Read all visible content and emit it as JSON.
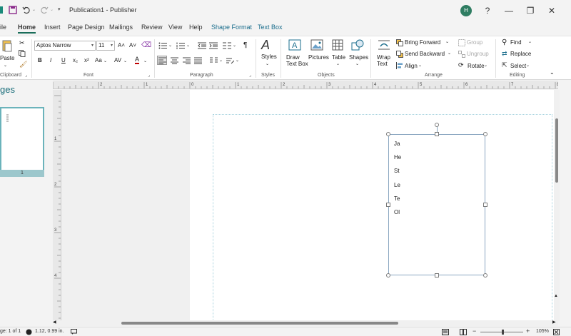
{
  "titlebar": {
    "title": "Publication1  -  Publisher",
    "avatar_initial": "H",
    "help": "?",
    "minimize": "—",
    "restore": "❐",
    "close": "✕"
  },
  "tabs": [
    "ile",
    "Home",
    "Insert",
    "Page Design",
    "Mailings",
    "Review",
    "View",
    "Help",
    "Shape Format",
    "Text Box"
  ],
  "ribbon": {
    "clipboard": {
      "paste": "Paste",
      "label": "Clipboard"
    },
    "font": {
      "name": "Aptos Narrow",
      "size": "11",
      "label": "Font",
      "bold": "B",
      "italic": "I",
      "underline": "U",
      "subscript": "x₂",
      "superscript": "x²",
      "change_case": "Aa",
      "spacing": "AV",
      "grow": "A˄",
      "shrink": "A˅",
      "color": "A"
    },
    "paragraph": {
      "label": "Paragraph"
    },
    "styles": {
      "button": "Styles",
      "label": "Styles"
    },
    "objects": {
      "draw_text_box": "Draw\nText Box",
      "pictures": "Pictures",
      "table": "Table",
      "shapes": "Shapes",
      "label": "Objects"
    },
    "arrange": {
      "wrap_text": "Wrap\nText",
      "bring_forward": "Bring Forward",
      "send_backward": "Send Backward",
      "align": "Align",
      "group": "Group",
      "ungroup": "Ungroup",
      "rotate": "Rotate",
      "label": "Arrange"
    },
    "editing": {
      "find": "Find",
      "replace": "Replace",
      "select": "Select",
      "label": "Editing"
    }
  },
  "pages_pane": {
    "title": "ges",
    "page_number": "1"
  },
  "ruler": {
    "top_labels": [
      "2",
      "1",
      "0",
      "1",
      "2",
      "3",
      "4",
      "5",
      "6",
      "7",
      "8"
    ],
    "left_labels": [
      "1",
      "2",
      "3",
      "4"
    ]
  },
  "textbox_lines": [
    "Ja",
    "He",
    "St",
    "Le",
    "Te",
    "Ol"
  ],
  "statusbar": {
    "page": "ge: 1 of 1",
    "position": "1.12, 0.99 in.",
    "zoom": "105%"
  },
  "colors": {
    "accent": "#1a6d5a",
    "contextual_tab": "#1a6d8c",
    "avatar": "#2f7d62"
  }
}
